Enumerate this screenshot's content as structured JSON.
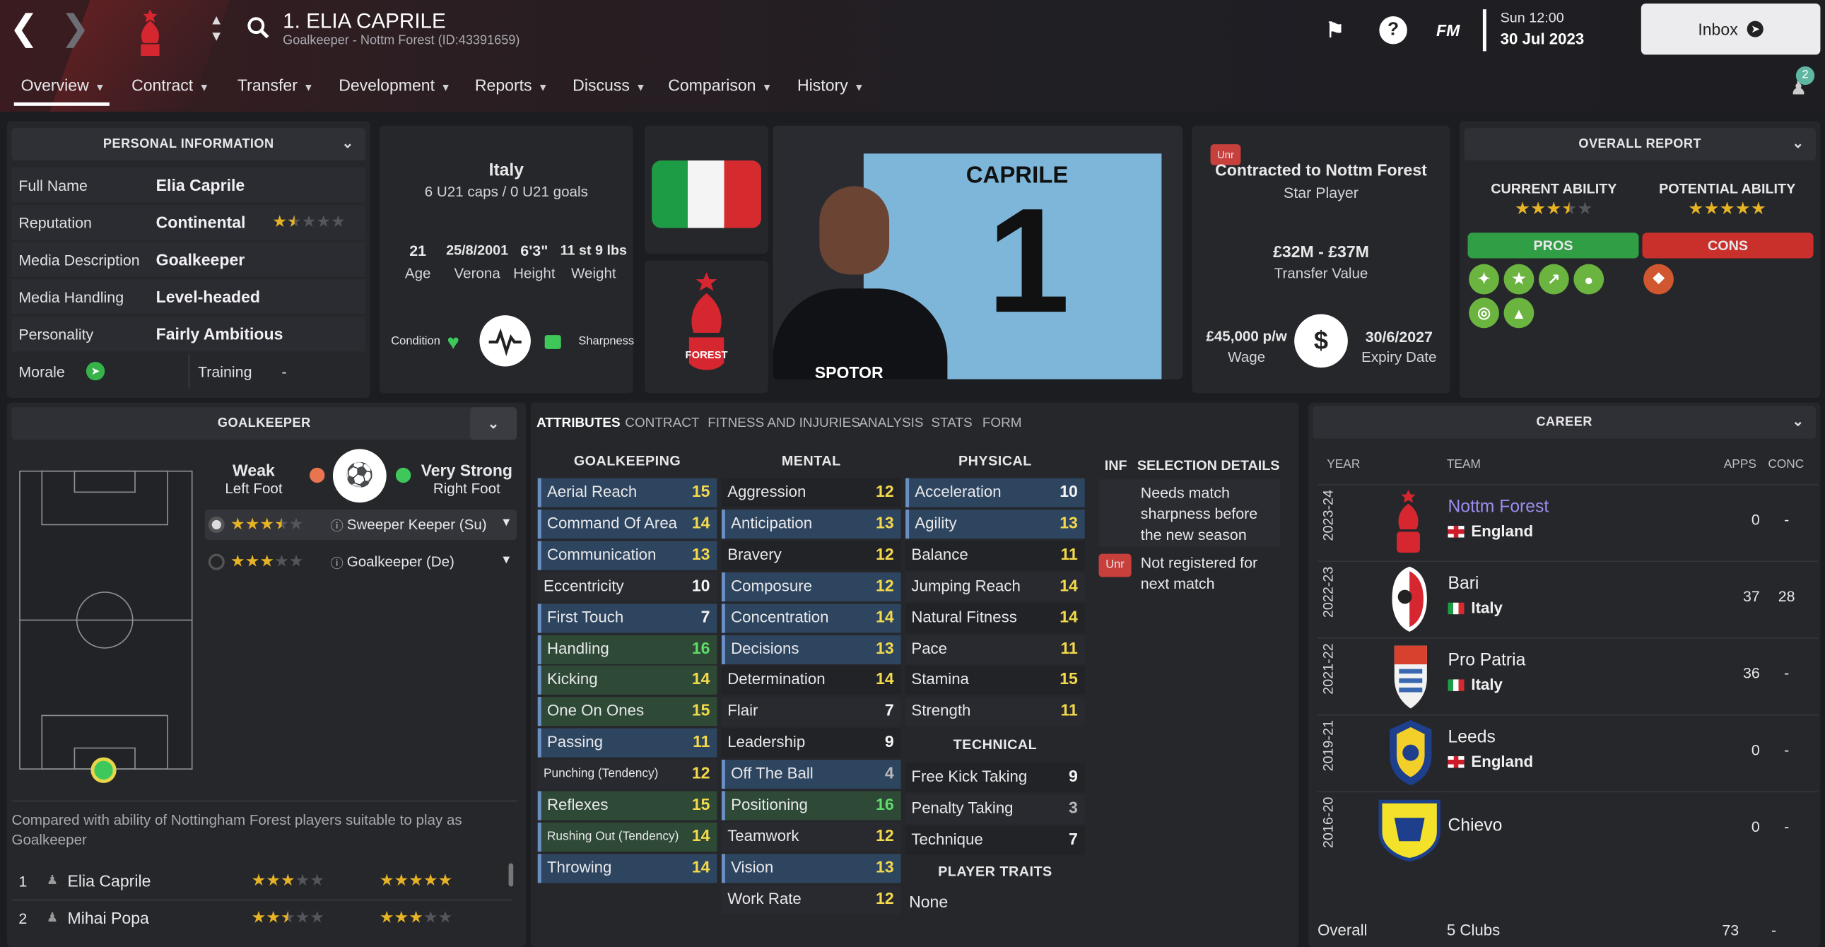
{
  "header": {
    "player_title": "1. ELIA CAPRILE",
    "subtitle": "Goalkeeper - Nottm Forest (ID:43391659)",
    "fm_label": "FM",
    "day_time": "Sun 12:00",
    "date": "30 Jul 2023",
    "inbox_label": "Inbox",
    "notification_count": "2",
    "tabs": [
      "Overview",
      "Contract",
      "Transfer",
      "Development",
      "Reports",
      "Discuss",
      "Comparison",
      "History"
    ]
  },
  "personal": {
    "title": "PERSONAL INFORMATION",
    "rows": [
      {
        "label": "Full Name",
        "value": "Elia Caprile"
      },
      {
        "label": "Reputation",
        "value": "Continental"
      },
      {
        "label": "Media Description",
        "value": "Goalkeeper"
      },
      {
        "label": "Media Handling",
        "value": "Level-headed"
      },
      {
        "label": "Personality",
        "value": "Fairly Ambitious"
      }
    ],
    "reputation_stars": 1.5,
    "morale_label": "Morale",
    "training_label": "Training",
    "training_value": "-"
  },
  "bio": {
    "nation": "Italy",
    "caps": "6 U21 caps / 0 U21 goals",
    "age": "21",
    "age_label": "Age",
    "dob": "25/8/2001",
    "birthplace": "Verona",
    "height": "6'3\"",
    "height_label": "Height",
    "weight": "11 st 9 lbs",
    "weight_label": "Weight",
    "condition_label": "Condition",
    "sharpness_label": "Sharpness"
  },
  "photo": {
    "shirt_name": "CAPRILE",
    "shirt_number": "1",
    "sponsor": "SPOTOR"
  },
  "contract": {
    "badge": "Unr",
    "status": "Contracted to Nottm Forest",
    "role": "Star Player",
    "value": "£32M - £37M",
    "value_label": "Transfer Value",
    "wage": "£45,000 p/w",
    "wage_label": "Wage",
    "expiry": "30/6/2027",
    "expiry_label": "Expiry Date"
  },
  "report": {
    "title": "OVERALL REPORT",
    "current_label": "CURRENT ABILITY",
    "current_stars": 3.5,
    "potential_label": "POTENTIAL ABILITY",
    "potential_stars": 5,
    "pros_label": "PROS",
    "cons_label": "CONS",
    "colors": {
      "pros": "#2f9e44",
      "cons": "#c9302c"
    }
  },
  "position": {
    "title": "GOALKEEPER",
    "left_foot_rating": "Weak",
    "left_foot_label": "Left Foot",
    "right_foot_rating": "Very Strong",
    "right_foot_label": "Right Foot",
    "roles": [
      {
        "name": "Sweeper Keeper (Su)",
        "stars": 3.5
      },
      {
        "name": "Goalkeeper (De)",
        "stars": 3
      }
    ],
    "compare_note": "Compared with ability of Nottingham Forest players suitable to play as Goalkeeper",
    "compare": [
      {
        "rank": "1",
        "name": "Elia Caprile",
        "ca": 3,
        "pa": 5
      },
      {
        "rank": "2",
        "name": "Mihai Popa",
        "ca": 2.5,
        "pa": 3
      }
    ]
  },
  "attributes": {
    "tabs": [
      "ATTRIBUTES",
      "CONTRACT",
      "FITNESS AND INJURIES",
      "ANALYSIS",
      "STATS",
      "FORM"
    ],
    "goalkeeping_title": "GOALKEEPING",
    "mental_title": "MENTAL",
    "physical_title": "PHYSICAL",
    "technical_title": "TECHNICAL",
    "traits_title": "PLAYER TRAITS",
    "traits_value": "None",
    "goalkeeping": [
      {
        "n": "Aerial Reach",
        "v": "15"
      },
      {
        "n": "Command Of Area",
        "v": "14"
      },
      {
        "n": "Communication",
        "v": "13"
      },
      {
        "n": "Eccentricity",
        "v": "10"
      },
      {
        "n": "First Touch",
        "v": "7"
      },
      {
        "n": "Handling",
        "v": "16"
      },
      {
        "n": "Kicking",
        "v": "14"
      },
      {
        "n": "One On Ones",
        "v": "15"
      },
      {
        "n": "Passing",
        "v": "11"
      },
      {
        "n": "Punching (Tendency)",
        "v": "12"
      },
      {
        "n": "Reflexes",
        "v": "15"
      },
      {
        "n": "Rushing Out (Tendency)",
        "v": "14"
      },
      {
        "n": "Throwing",
        "v": "14"
      }
    ],
    "mental": [
      {
        "n": "Aggression",
        "v": "12"
      },
      {
        "n": "Anticipation",
        "v": "13"
      },
      {
        "n": "Bravery",
        "v": "12"
      },
      {
        "n": "Composure",
        "v": "12"
      },
      {
        "n": "Concentration",
        "v": "14"
      },
      {
        "n": "Decisions",
        "v": "13"
      },
      {
        "n": "Determination",
        "v": "14"
      },
      {
        "n": "Flair",
        "v": "7"
      },
      {
        "n": "Leadership",
        "v": "9"
      },
      {
        "n": "Off The Ball",
        "v": "4"
      },
      {
        "n": "Positioning",
        "v": "16"
      },
      {
        "n": "Teamwork",
        "v": "12"
      },
      {
        "n": "Vision",
        "v": "13"
      },
      {
        "n": "Work Rate",
        "v": "12"
      }
    ],
    "physical": [
      {
        "n": "Acceleration",
        "v": "10"
      },
      {
        "n": "Agility",
        "v": "13"
      },
      {
        "n": "Balance",
        "v": "11"
      },
      {
        "n": "Jumping Reach",
        "v": "14"
      },
      {
        "n": "Natural Fitness",
        "v": "14"
      },
      {
        "n": "Pace",
        "v": "11"
      },
      {
        "n": "Stamina",
        "v": "15"
      },
      {
        "n": "Strength",
        "v": "11"
      }
    ],
    "technical": [
      {
        "n": "Free Kick Taking",
        "v": "9"
      },
      {
        "n": "Penalty Taking",
        "v": "3"
      },
      {
        "n": "Technique",
        "v": "7"
      }
    ]
  },
  "selection": {
    "inf_label": "INF",
    "title": "SELECTION DETAILS",
    "items": [
      {
        "badge": "",
        "text": "Needs match sharpness before the new season"
      },
      {
        "badge": "Unr",
        "text": "Not registered for next match"
      }
    ]
  },
  "career": {
    "title": "CAREER",
    "headers": {
      "year": "YEAR",
      "team": "TEAM",
      "apps": "APPS",
      "conc": "CONC"
    },
    "rows": [
      {
        "year": "2023-24",
        "team": "Nottm Forest",
        "nation": "England",
        "apps": "0",
        "conc": "-"
      },
      {
        "year": "2022-23",
        "team": "Bari",
        "nation": "Italy",
        "apps": "37",
        "conc": "28"
      },
      {
        "year": "2021-22",
        "team": "Pro Patria",
        "nation": "Italy",
        "apps": "36",
        "conc": "-"
      },
      {
        "year": "2019-21",
        "team": "Leeds",
        "nation": "England",
        "apps": "0",
        "conc": "-"
      },
      {
        "year": "2016-20",
        "team": "Chievo",
        "nation": "",
        "apps": "0",
        "conc": "-"
      }
    ],
    "overall_label": "Overall",
    "overall_clubs": "5 Clubs",
    "overall_apps": "73",
    "overall_conc": "-"
  }
}
